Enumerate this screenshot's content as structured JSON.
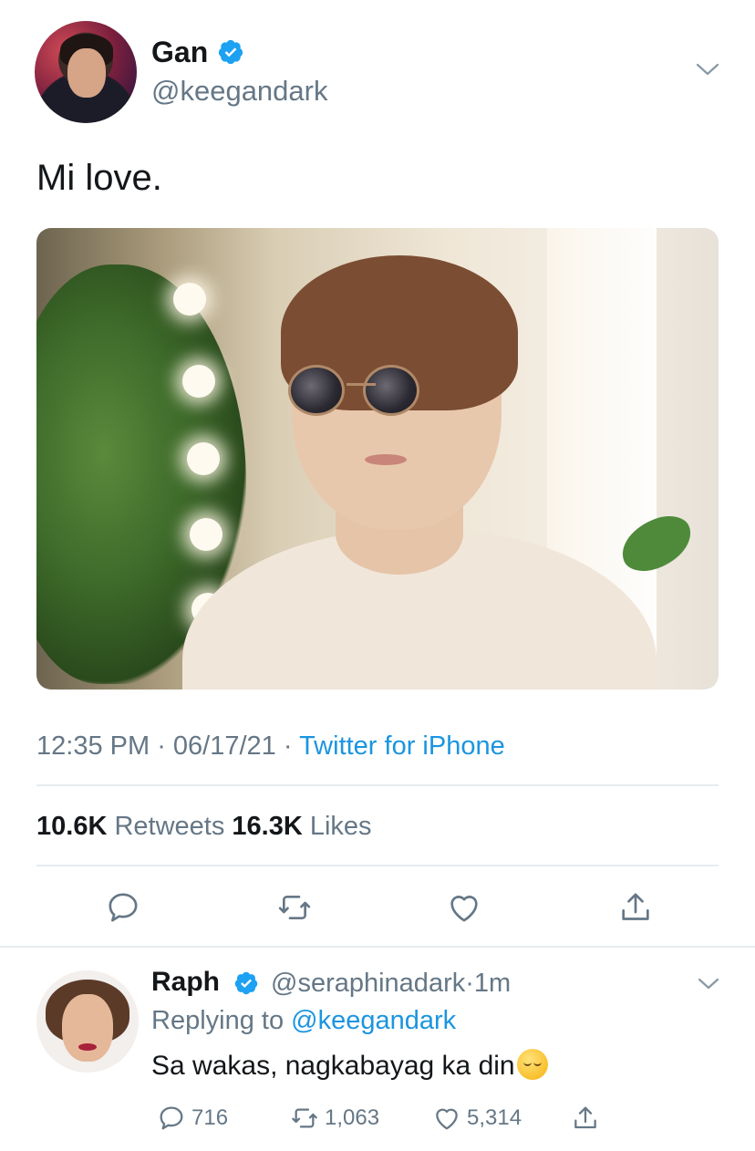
{
  "tweet": {
    "name": "Gan",
    "handle": "@keegandark",
    "text": "Mi love.",
    "time": "12:35 PM",
    "sep1": " · ",
    "date": "06/17/21",
    "sep2": " · ",
    "source": "Twitter for iPhone",
    "retweets_count": "10.6K",
    "retweets_label": "Retweets",
    "likes_count": "16.3K",
    "likes_label": "Likes",
    "icons": [
      "reply-icon",
      "retweet-icon",
      "like-icon",
      "share-icon"
    ]
  },
  "reply": {
    "name": "Raph",
    "handle": "@seraphinadark",
    "time": "·1m",
    "replying_prefix": "Replying to ",
    "replying_to": "@keegandark",
    "text": "Sa wakas, nagkabayag ka din",
    "reply_count": "716",
    "retweet_count": "1,063",
    "like_count": "5,314"
  },
  "colors": {
    "text": "#14171a",
    "secondary": "#657786",
    "link": "#1b95e0",
    "verified": "#1da1f2",
    "divider": "#e6ecf0"
  }
}
